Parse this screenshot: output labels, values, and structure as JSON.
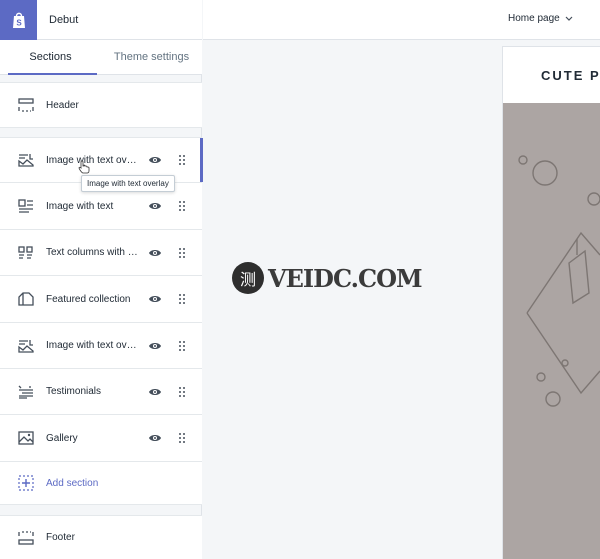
{
  "app": {
    "theme_name": "Debut",
    "logo_icon": "shopify-bag-icon",
    "accent_color": "#5c6ac4"
  },
  "tabs": [
    {
      "label": "Sections",
      "active": true
    },
    {
      "label": "Theme settings",
      "active": false
    }
  ],
  "header_section": {
    "label": "Header",
    "icon": "header-icon"
  },
  "sections": [
    {
      "label": "Image with text overlay",
      "icon": "image-overlay-icon",
      "selected": true
    },
    {
      "label": "Image with text",
      "icon": "image-text-icon"
    },
    {
      "label": "Text columns with images",
      "icon": "columns-icon"
    },
    {
      "label": "Featured collection",
      "icon": "collection-icon"
    },
    {
      "label": "Image with text overlay",
      "icon": "image-overlay-icon"
    },
    {
      "label": "Testimonials",
      "icon": "testimonials-icon"
    },
    {
      "label": "Gallery",
      "icon": "gallery-icon"
    }
  ],
  "add_section": {
    "label": "Add section",
    "icon": "add-icon"
  },
  "footer_section": {
    "label": "Footer",
    "icon": "footer-icon"
  },
  "tooltip": {
    "text": "Image with text overlay"
  },
  "page_selector": {
    "value": "Home page"
  },
  "preview": {
    "store_title": "CUTE P",
    "hero_color": "#aca5a3"
  },
  "watermark": {
    "glyph": "测",
    "text": "VEIDC.COM"
  }
}
